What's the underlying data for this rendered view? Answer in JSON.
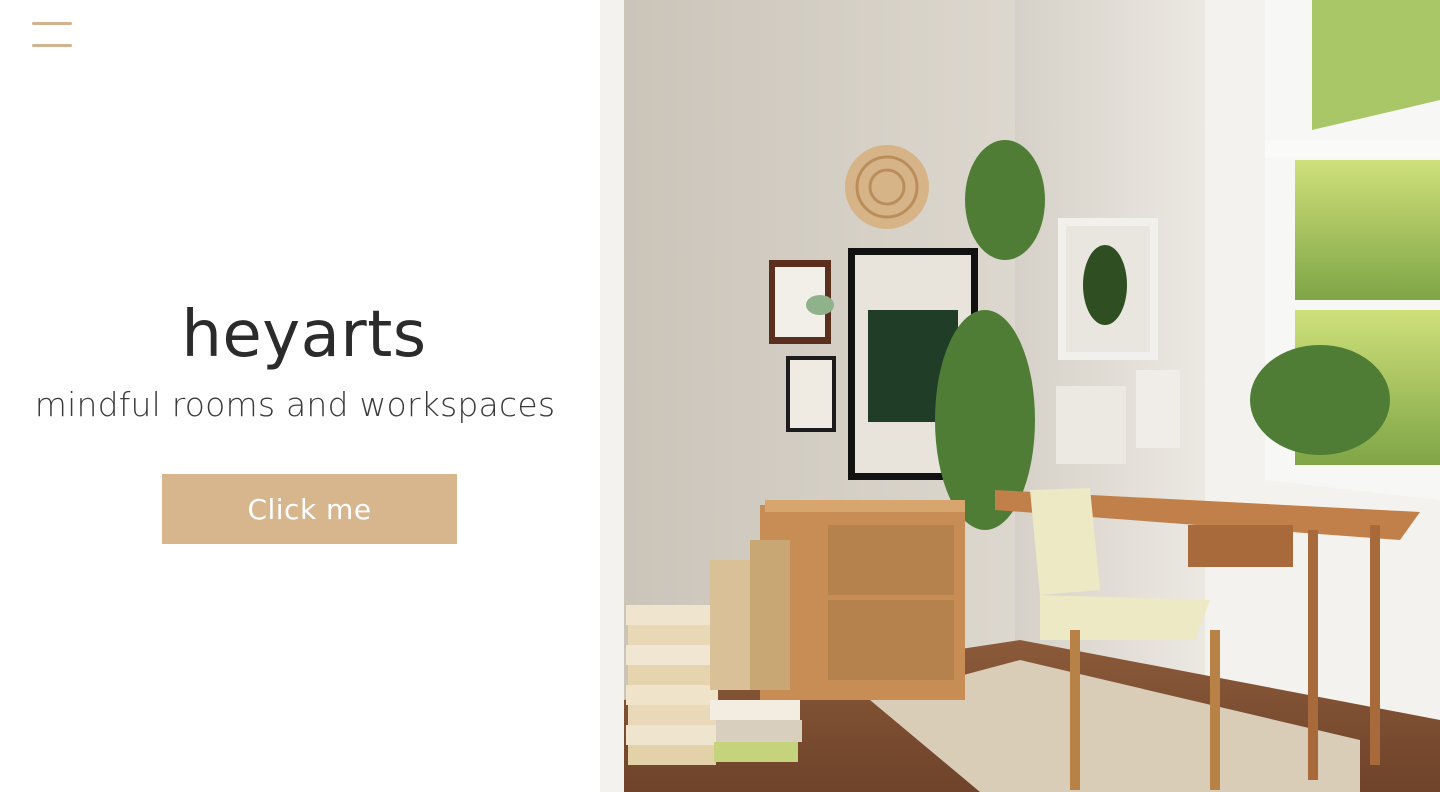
{
  "header": {
    "menu_icon": "hamburger-menu-icon"
  },
  "hero": {
    "brand": "heyarts",
    "tagline": "mindful rooms and workspaces",
    "cta_label": "Click me"
  },
  "colors": {
    "accent": "#d7b58d",
    "text": "#2b2b2b",
    "background": "#ffffff"
  }
}
